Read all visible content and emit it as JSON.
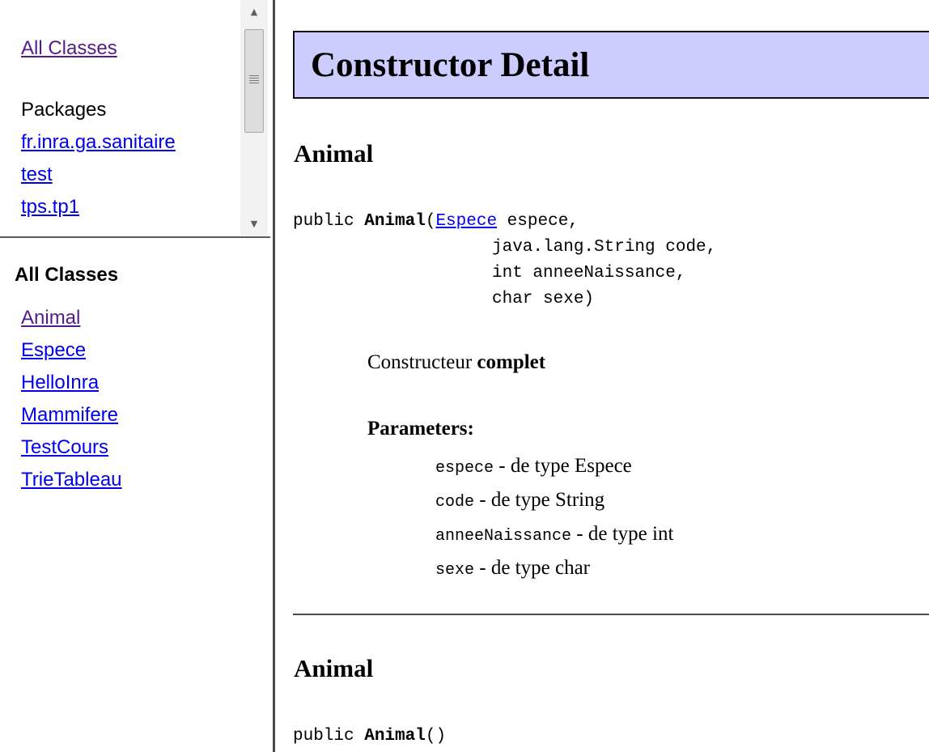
{
  "package_frame": {
    "all_classes_link": "All Classes",
    "packages_heading": "Packages",
    "packages": [
      "fr.inra.ga.sanitaire",
      "test",
      "tps.tp1"
    ],
    "scroll_up": "▲",
    "scroll_down": "▼"
  },
  "classes_frame": {
    "heading": "All Classes",
    "classes": [
      "Animal",
      "Espece",
      "HelloInra",
      "Mammifere",
      "TestCours",
      "TrieTableau"
    ]
  },
  "main": {
    "section_title": "Constructor Detail",
    "constructors": [
      {
        "name": "Animal",
        "signature": {
          "modifier": "public ",
          "name": "Animal",
          "open_paren": "(",
          "first_param_type": "Espece",
          "first_param_rest": " espece,",
          "other_params": [
            "java.lang.String code,",
            "int anneeNaissance,",
            "char sexe)"
          ]
        },
        "description_prefix": "Constructeur ",
        "description_bold": "complet",
        "parameters_label": "Parameters:",
        "parameters": [
          {
            "name": "espece",
            "desc": " - de type Espece"
          },
          {
            "name": "code",
            "desc": " - de type String"
          },
          {
            "name": "anneeNaissance",
            "desc": " - de type int"
          },
          {
            "name": "sexe",
            "desc": " - de type char"
          }
        ]
      },
      {
        "name": "Animal",
        "signature": {
          "modifier": "public ",
          "name": "Animal",
          "parens": "()"
        }
      }
    ]
  }
}
